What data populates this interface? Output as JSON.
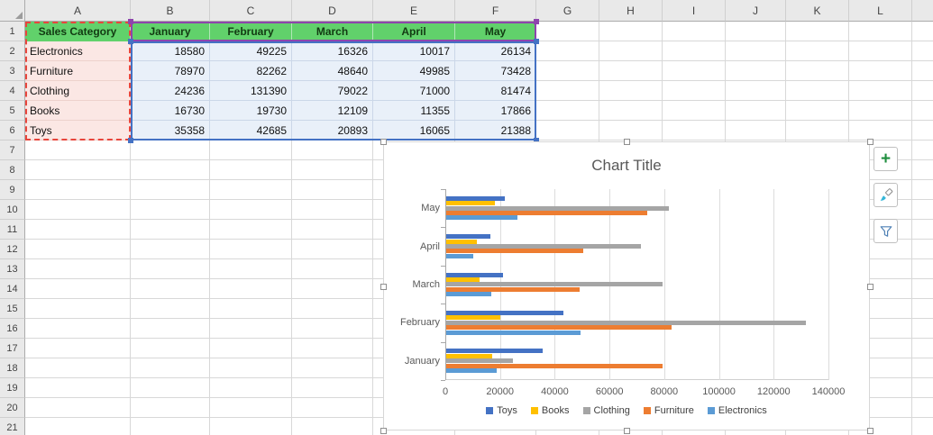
{
  "spreadsheet": {
    "column_headers": [
      "A",
      "B",
      "C",
      "D",
      "E",
      "F",
      "G",
      "H",
      "I",
      "J",
      "K",
      "L"
    ],
    "row_headers": [
      "1",
      "2",
      "3",
      "4",
      "5",
      "6",
      "7",
      "8",
      "9",
      "10",
      "11",
      "12",
      "13",
      "14",
      "15",
      "16",
      "17",
      "18",
      "19",
      "20",
      "21"
    ],
    "table": {
      "columns": [
        "Sales Category",
        "January",
        "February",
        "March",
        "April",
        "May"
      ],
      "rows": [
        {
          "category": "Electronics",
          "values": [
            18580,
            49225,
            16326,
            10017,
            26134
          ]
        },
        {
          "category": "Furniture",
          "values": [
            78970,
            82262,
            48640,
            49985,
            73428
          ]
        },
        {
          "category": "Clothing",
          "values": [
            24236,
            131390,
            79022,
            71000,
            81474
          ]
        },
        {
          "category": "Books",
          "values": [
            16730,
            19730,
            12109,
            11355,
            17866
          ]
        },
        {
          "category": "Toys",
          "values": [
            35358,
            42685,
            20893,
            16065,
            21388
          ]
        }
      ]
    },
    "colors": {
      "header_fill": "#61D16B",
      "header_text": "#123A12",
      "category_fill": "#FBE7E4",
      "category_range_border": "#E8453C",
      "value_fill": "#E9F0F9",
      "value_range_border": "#4472C4",
      "series_name_range_border": "#8E44AD"
    }
  },
  "chart_data": {
    "type": "bar",
    "orientation": "horizontal",
    "title": "Chart Title",
    "categories": [
      "January",
      "February",
      "March",
      "April",
      "May"
    ],
    "category_display_order_top_to_bottom": [
      "May",
      "April",
      "March",
      "February",
      "January"
    ],
    "series": [
      {
        "name": "Toys",
        "color": "#4472C4",
        "values": [
          35358,
          42685,
          20893,
          16065,
          21388
        ]
      },
      {
        "name": "Books",
        "color": "#FFC000",
        "values": [
          16730,
          19730,
          12109,
          11355,
          17866
        ]
      },
      {
        "name": "Clothing",
        "color": "#A5A5A5",
        "values": [
          24236,
          131390,
          79022,
          71000,
          81474
        ]
      },
      {
        "name": "Furniture",
        "color": "#ED7D31",
        "values": [
          78970,
          82262,
          48640,
          49985,
          73428
        ]
      },
      {
        "name": "Electronics",
        "color": "#5B9BD5",
        "values": [
          18580,
          49225,
          16326,
          10017,
          26134
        ]
      }
    ],
    "xlim": [
      0,
      140000
    ],
    "x_ticks": [
      0,
      20000,
      40000,
      60000,
      80000,
      100000,
      120000,
      140000
    ],
    "grid": true,
    "legend": {
      "position": "bottom",
      "items": [
        "Toys",
        "Books",
        "Clothing",
        "Furniture",
        "Electronics"
      ]
    }
  },
  "chart_tools": {
    "add_label": "+"
  }
}
